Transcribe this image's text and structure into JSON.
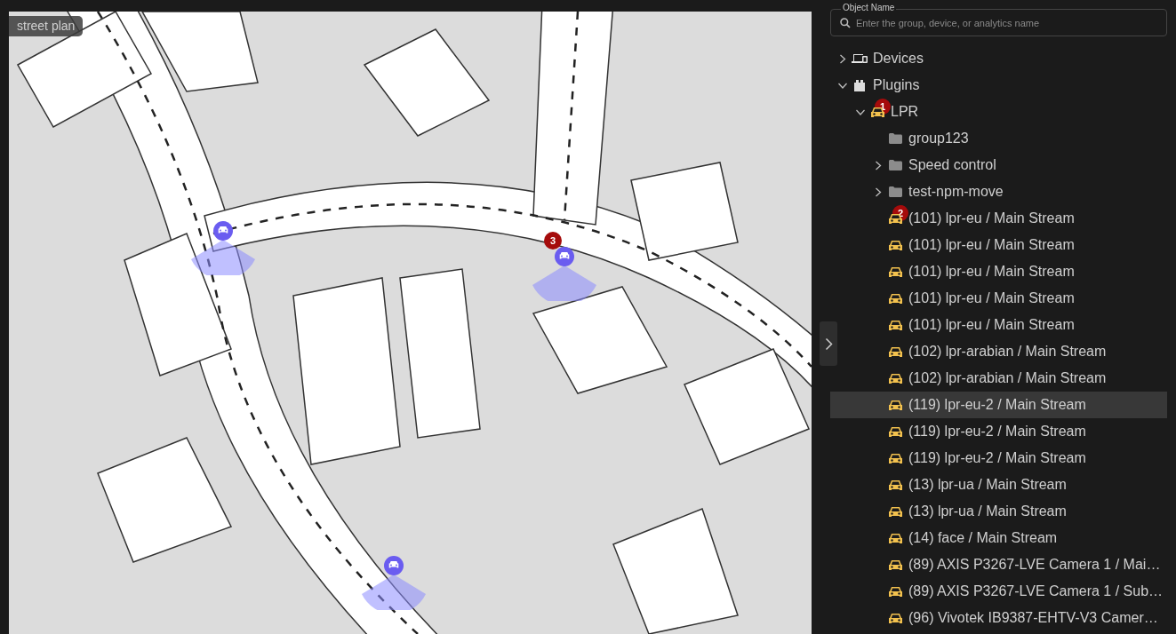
{
  "map": {
    "label": "street plan",
    "camera_badge": "3"
  },
  "search": {
    "label": "Object Name",
    "placeholder": "Enter the group, device, or analytics name"
  },
  "tree": [
    {
      "kind": "devices",
      "label": "Devices",
      "expanded": false,
      "selected": false
    },
    {
      "kind": "plugins",
      "label": "Plugins",
      "expanded": true,
      "selected": false,
      "children": [
        {
          "kind": "plugin",
          "label": "LPR",
          "expanded": true,
          "selected": false,
          "badge": "1",
          "children": [
            {
              "kind": "folder",
              "label": "group123",
              "selected": false
            },
            {
              "kind": "folder",
              "label": "Speed control",
              "expanded": false,
              "selected": false
            },
            {
              "kind": "folder",
              "label": "test-npm-move",
              "expanded": false,
              "selected": false
            },
            {
              "kind": "stream",
              "label": "(101) lpr-eu / Main Stream",
              "selected": false,
              "badge": "2"
            },
            {
              "kind": "stream",
              "label": "(101) lpr-eu / Main Stream",
              "selected": false
            },
            {
              "kind": "stream",
              "label": "(101) lpr-eu / Main Stream",
              "selected": false
            },
            {
              "kind": "stream",
              "label": "(101) lpr-eu / Main Stream",
              "selected": false
            },
            {
              "kind": "stream",
              "label": "(101) lpr-eu / Main Stream",
              "selected": false
            },
            {
              "kind": "stream",
              "label": "(102) lpr-arabian / Main Stream",
              "selected": false
            },
            {
              "kind": "stream",
              "label": "(102) lpr-arabian / Main Stream",
              "selected": false
            },
            {
              "kind": "stream",
              "label": "(119) lpr-eu-2 / Main Stream",
              "selected": true
            },
            {
              "kind": "stream",
              "label": "(119) lpr-eu-2 / Main Stream",
              "selected": false
            },
            {
              "kind": "stream",
              "label": "(119) lpr-eu-2 / Main Stream",
              "selected": false
            },
            {
              "kind": "stream",
              "label": "(13) lpr-ua / Main Stream",
              "selected": false
            },
            {
              "kind": "stream",
              "label": "(13) lpr-ua / Main Stream",
              "selected": false
            },
            {
              "kind": "stream",
              "label": "(14) face / Main Stream",
              "selected": false
            },
            {
              "kind": "stream",
              "label": "(89) AXIS P3267-LVE Camera 1 / Mai…",
              "selected": false
            },
            {
              "kind": "stream",
              "label": "(89) AXIS P3267-LVE Camera 1 / Sub…",
              "selected": false
            },
            {
              "kind": "stream",
              "label": "(96) Vivotek IB9387-EHTV-V3 Camer…",
              "selected": false
            }
          ]
        }
      ]
    }
  ]
}
